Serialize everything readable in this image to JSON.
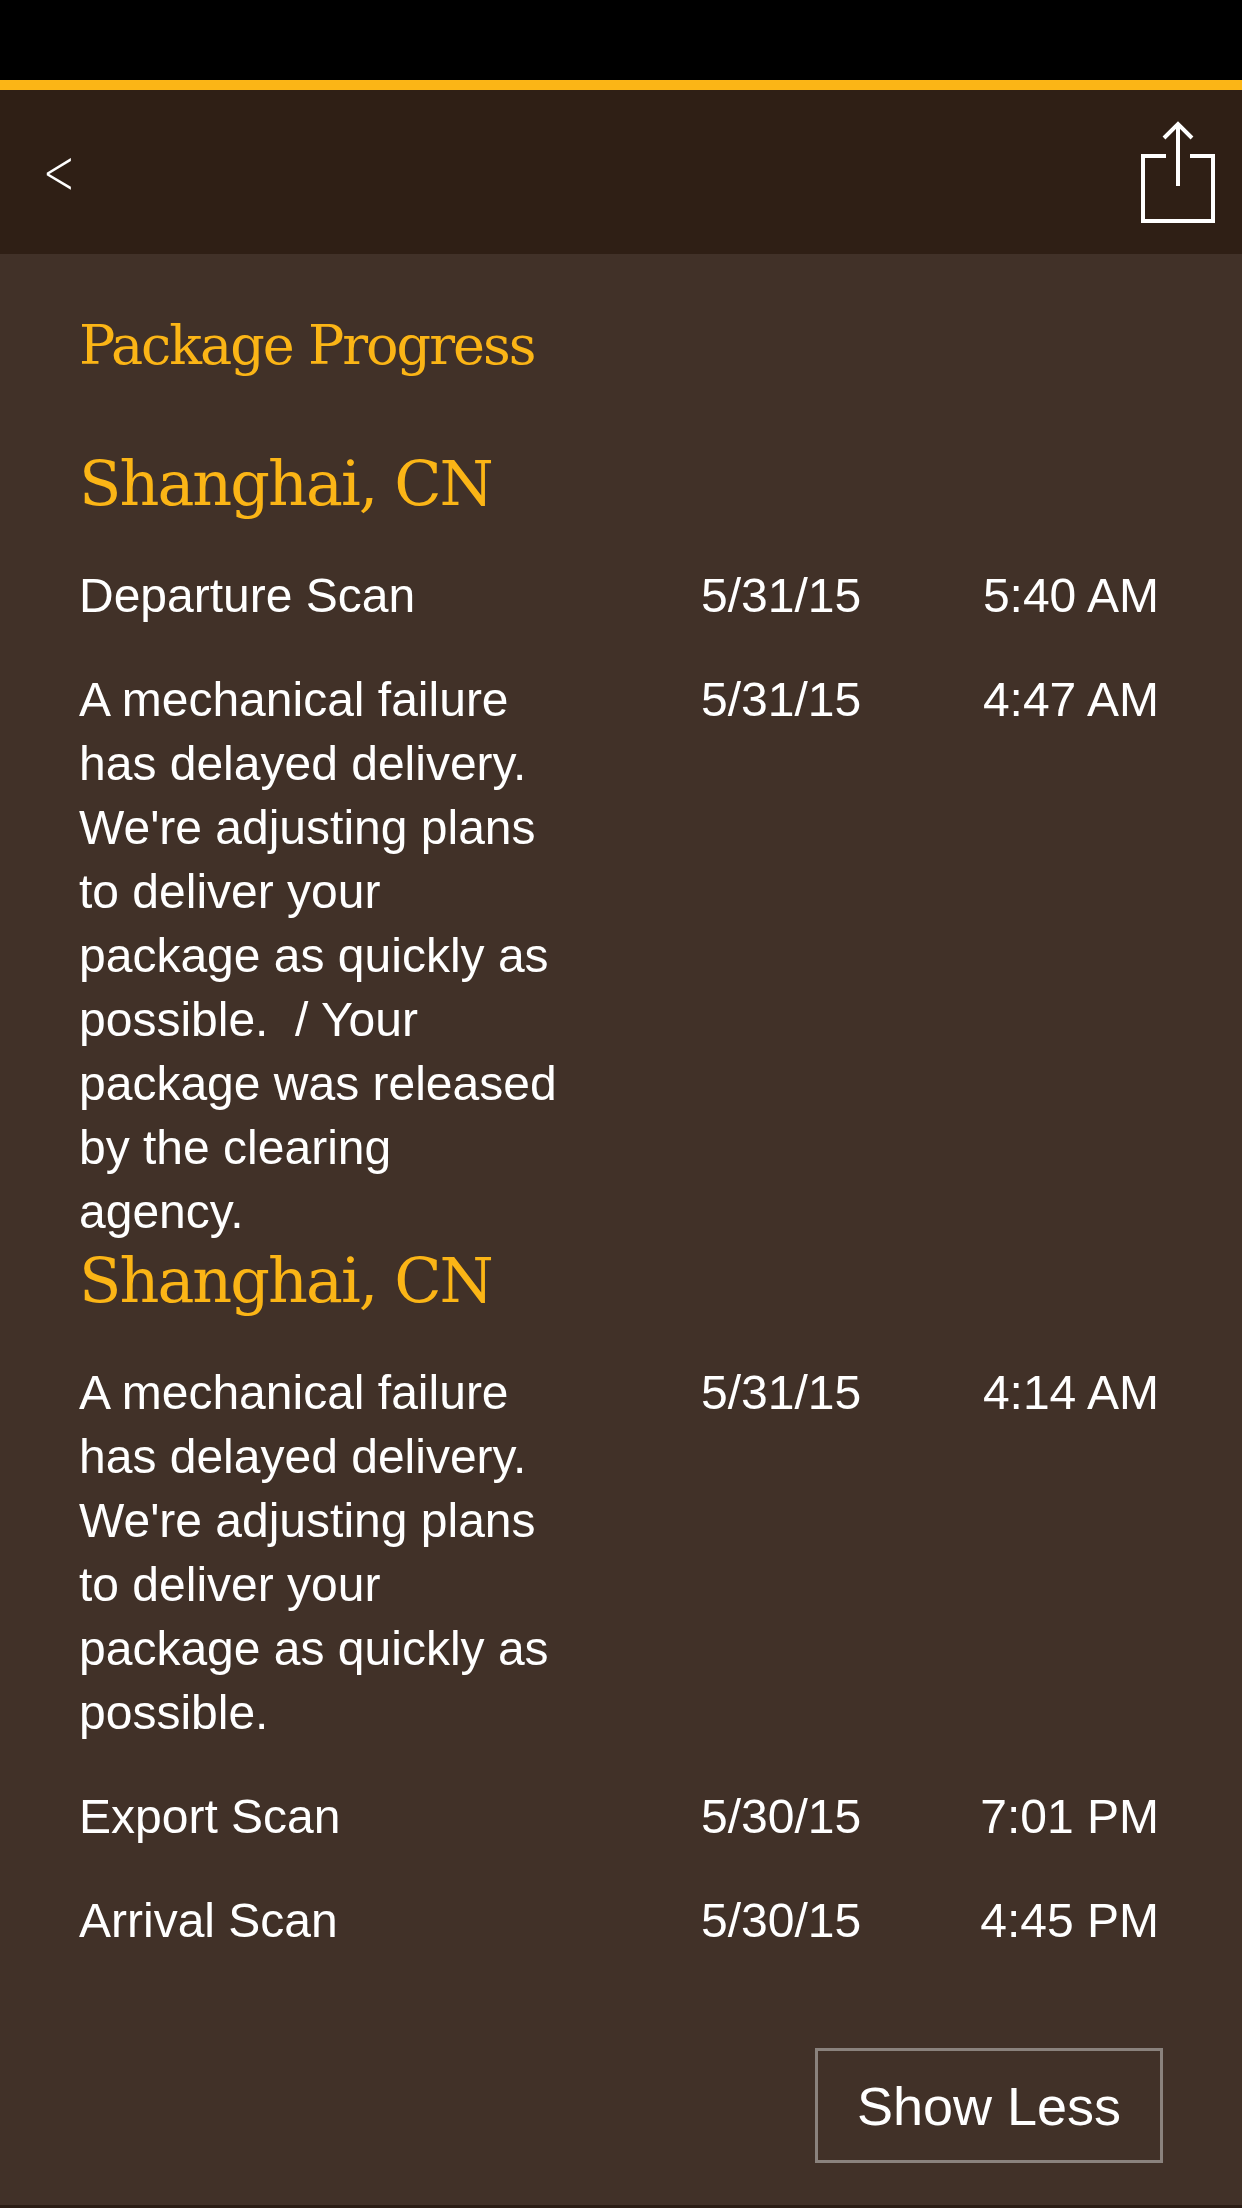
{
  "header": {
    "back": "<"
  },
  "title": "Package Progress",
  "groups": [
    {
      "location": "Shanghai, CN",
      "events": [
        {
          "description": "Departure Scan",
          "date": "5/31/15",
          "time": "5:40 AM"
        },
        {
          "description": "A mechanical failure has delayed delivery. We're adjusting plans to deliver your package as quickly as possible.  / Your package was released by the clearing agency.",
          "date": "5/31/15",
          "time": "4:47 AM"
        }
      ]
    },
    {
      "location": "Shanghai, CN",
      "events": [
        {
          "description": "A mechanical failure has delayed delivery. We're adjusting plans to deliver your package as quickly as possible.",
          "date": "5/31/15",
          "time": "4:14 AM"
        },
        {
          "description": "Export Scan",
          "date": "5/30/15",
          "time": "7:01 PM"
        },
        {
          "description": "Arrival Scan",
          "date": "5/30/15",
          "time": "4:45 PM"
        }
      ]
    }
  ],
  "button": "Show Less"
}
